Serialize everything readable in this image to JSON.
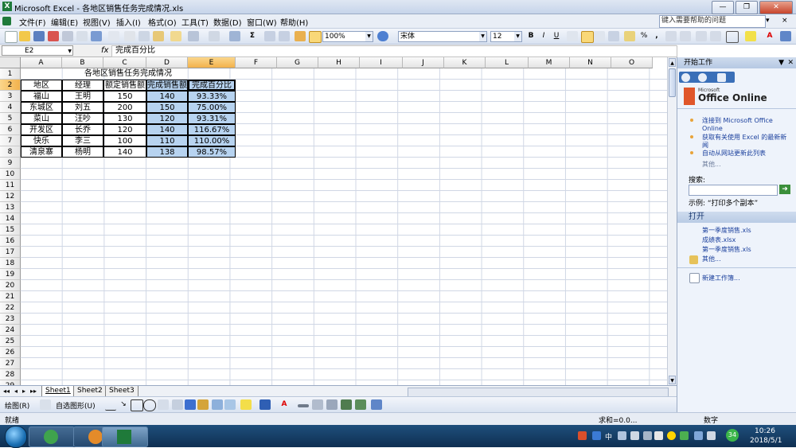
{
  "window": {
    "title": "Microsoft Excel - 各地区销售任务完成情况.xls",
    "app_icon": "X",
    "min": "—",
    "max": "❐",
    "close": "✕"
  },
  "menu": {
    "items": [
      "文件(F)",
      "编辑(E)",
      "视图(V)",
      "插入(I)",
      "格式(O)",
      "工具(T)",
      "数据(D)",
      "窗口(W)",
      "帮助(H)"
    ],
    "help_placeholder": "键入需要帮助的问题",
    "help_arrow": "▾",
    "close_doc": "× "
  },
  "toolbar": {
    "zoom": "100%",
    "font_name": "宋体",
    "font_size": "12",
    "bold": "B",
    "italic": "I",
    "underline": "U",
    "sum": "Σ",
    "percent": "%",
    "comma": ","
  },
  "formula": {
    "cell_ref": "E2",
    "fx": "fx",
    "content": "完成百分比"
  },
  "columns": [
    "A",
    "B",
    "C",
    "D",
    "E",
    "F",
    "G",
    "H",
    "I",
    "J",
    "K",
    "L",
    "M",
    "N",
    "O"
  ],
  "rows": [
    "1",
    "2",
    "3",
    "4",
    "5",
    "6",
    "7",
    "8",
    "9",
    "10",
    "11",
    "12",
    "13",
    "14",
    "15",
    "16",
    "17",
    "18",
    "19",
    "20",
    "21",
    "22",
    "23",
    "24",
    "25",
    "26",
    "27",
    "28",
    "29"
  ],
  "sheet": {
    "title": "各地区销售任务完成情况",
    "headers": [
      "地区",
      "经理",
      "额定销售额",
      "完成销售额",
      "完成百分比"
    ],
    "data": [
      [
        "福山",
        "王明",
        "150",
        "140",
        "93.33%"
      ],
      [
        "东城区",
        "刘五",
        "200",
        "150",
        "75.00%"
      ],
      [
        "菜山",
        "汪吵",
        "130",
        "120",
        "93.31%"
      ],
      [
        "开发区",
        "长乔",
        "120",
        "140",
        "116.67%"
      ],
      [
        "快乐",
        "李三",
        "100",
        "110",
        "110.00%"
      ],
      [
        "清泉寨",
        "杨明",
        "140",
        "138",
        "98.57%"
      ]
    ]
  },
  "tabs": {
    "nav": [
      "◂◂",
      "◂",
      "▸",
      "▸▸"
    ],
    "sheets": [
      "Sheet1",
      "Sheet2",
      "Sheet3"
    ],
    "active": 0
  },
  "drawbar": {
    "draw_label": "绘图(R)",
    "autoshape_label": "自选图形(U)"
  },
  "status": {
    "left": "就绪",
    "right": "求和=0.0...",
    "num": "数字"
  },
  "taskpane": {
    "title": "开始工作",
    "brand_small": "Microsoft",
    "brand": "Office Online",
    "links": [
      "连接到 Microsoft Office Online",
      "获取有关使用 Excel 的最新新闻",
      "自动从网站更新此列表"
    ],
    "more": "其他...",
    "search_label": "搜索:",
    "search_arrow": "➜",
    "example": "示例: “打印多个副本”",
    "open_section": "打开",
    "files": [
      "第一季度销售.xls",
      "成绩表.xlsx",
      "第一季度销售.xls"
    ],
    "open_more": "其他...",
    "new_workbook": "新建工作簿..."
  },
  "taskbar": {
    "time": "10:26",
    "date": "2018/5/1",
    "ime": "中",
    "badge": "34"
  }
}
